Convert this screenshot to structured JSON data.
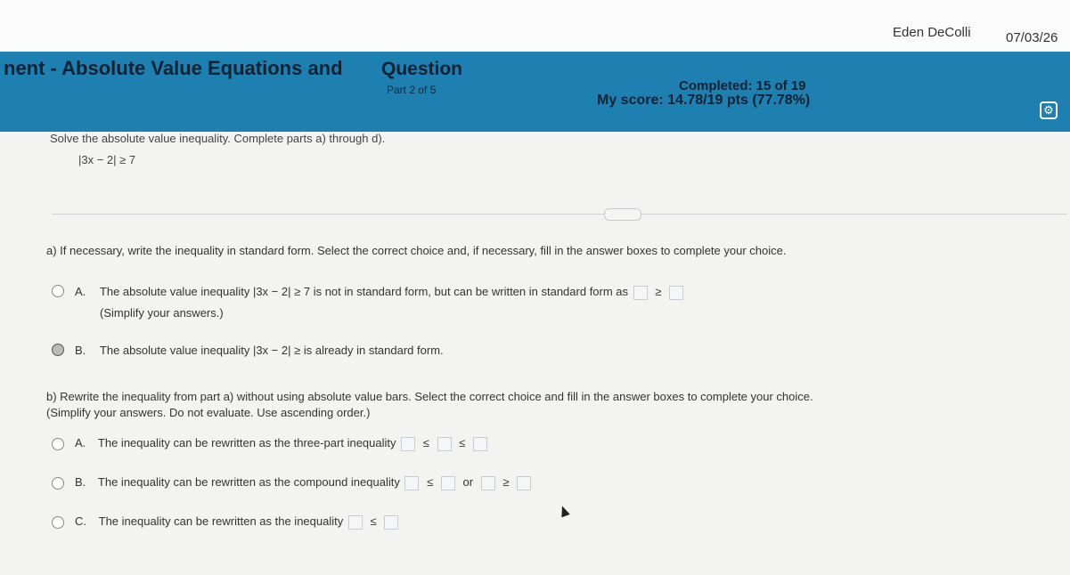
{
  "top": {
    "user": "Eden DeColli",
    "date": "07/03/26"
  },
  "header": {
    "title": "nent - Absolute Value Equations and",
    "question_label": "Question",
    "part": "Part 2 of 5",
    "completed": "Completed: 15 of 19",
    "score": "My score: 14.78/19 pts (77.78%)"
  },
  "problem": {
    "prompt": "Solve the absolute value inequality. Complete parts a) through d).",
    "expression": "|3x − 2| ≥ 7"
  },
  "part_a": {
    "instruction": "a) If necessary, write the inequality in standard form. Select the correct choice and, if necessary, fill in the answer boxes to complete your choice.",
    "choice_a": {
      "letter": "A.",
      "text1": "The absolute value inequality",
      "expr": "|3x − 2| ≥ 7",
      "text2": "is not in standard form, but can be written in standard form as",
      "rel": "≥",
      "note": "(Simplify your answers.)"
    },
    "choice_b": {
      "letter": "B.",
      "text1": "The absolute value inequality",
      "expr": "|3x − 2| ≥",
      "text2": "is already in standard form."
    }
  },
  "part_b": {
    "instruction": "b) Rewrite the inequality from part a) without using absolute value bars. Select the correct choice and fill in the answer boxes to complete your choice.",
    "note": "(Simplify your answers. Do not evaluate. Use ascending order.)",
    "choice_a": {
      "letter": "A.",
      "text": "The inequality can be rewritten as the three-part inequality",
      "s1": "≤",
      "s2": "≤"
    },
    "choice_b": {
      "letter": "B.",
      "text": "The inequality can be rewritten as the compound inequality",
      "s1": "≤",
      "or": "or",
      "s2": "≥"
    },
    "choice_c": {
      "letter": "C.",
      "text": "The inequality can be rewritten as the inequality",
      "s1": "≤"
    }
  }
}
